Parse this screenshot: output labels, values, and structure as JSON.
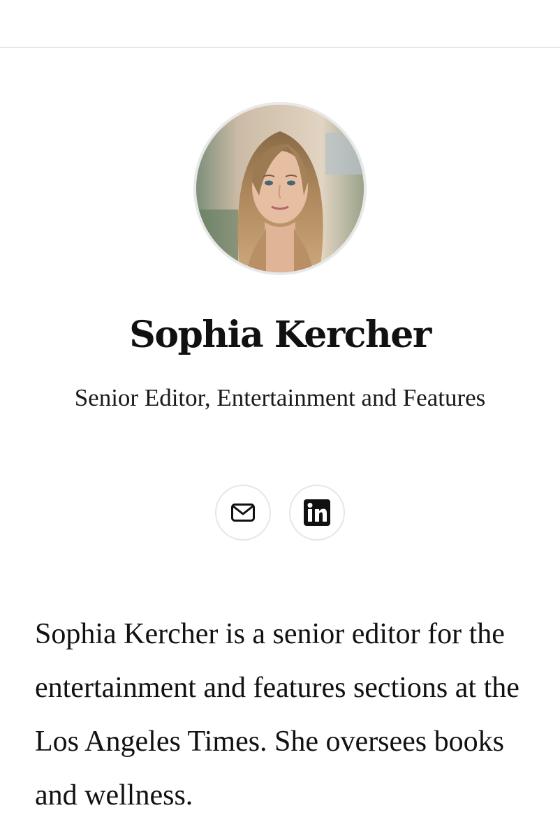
{
  "author": {
    "name": "Sophia Kercher",
    "title": "Senior Editor, Entertainment and Features",
    "photo_icon": "author-portrait",
    "bio": "Sophia Kercher is a senior editor for the entertainment and features sections at the Los Angeles Times. She oversees books and wellness."
  },
  "social": {
    "email_icon": "envelope-icon",
    "linkedin_icon": "linkedin-icon"
  },
  "colors": {
    "text": "#111111",
    "border": "#e6e6e6",
    "background": "#ffffff"
  }
}
